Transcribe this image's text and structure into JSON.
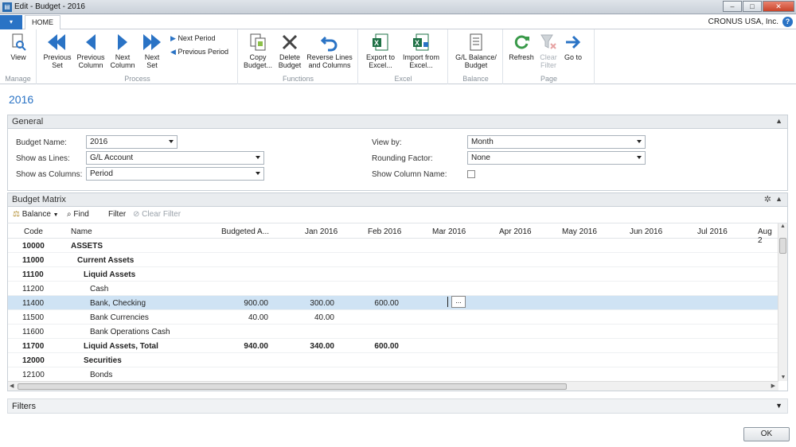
{
  "window": {
    "title": "Edit - Budget - 2016"
  },
  "tabs": {
    "file": "▾",
    "home": "HOME"
  },
  "company": "CRONUS USA, Inc.",
  "ribbon": {
    "view": "View",
    "manage": "Manage",
    "previous_set": "Previous Set",
    "previous_column": "Previous Column",
    "next_column": "Next Column",
    "next_set": "Next Set",
    "next_period": "Next Period",
    "previous_period": "Previous Period",
    "process": "Process",
    "copy_budget": "Copy Budget...",
    "delete_budget": "Delete Budget",
    "reverse_lines": "Reverse Lines and Columns",
    "functions": "Functions",
    "export_excel": "Export to Excel...",
    "import_excel": "Import from Excel...",
    "excel": "Excel",
    "gl_balance_budget": "G/L Balance/ Budget",
    "balance": "Balance",
    "refresh": "Refresh",
    "clear_filter": "Clear Filter",
    "go_to": "Go to",
    "page": "Page"
  },
  "page_title": "2016",
  "general": {
    "header": "General",
    "budget_name_label": "Budget Name:",
    "budget_name": "2016",
    "show_as_lines_label": "Show as Lines:",
    "show_as_lines": "G/L Account",
    "show_as_columns_label": "Show as Columns:",
    "show_as_columns": "Period",
    "view_by_label": "View by:",
    "view_by": "Month",
    "rounding_label": "Rounding Factor:",
    "rounding": "None",
    "show_column_name_label": "Show Column Name:"
  },
  "matrix": {
    "header": "Budget Matrix",
    "toolbar": {
      "balance": "Balance",
      "find": "Find",
      "filter": "Filter",
      "clear_filter": "Clear Filter"
    },
    "columns": [
      "Code",
      "Name",
      "Budgeted A...",
      "Jan 2016",
      "Feb 2016",
      "Mar 2016",
      "Apr 2016",
      "May 2016",
      "Jun 2016",
      "Jul 2016",
      "Aug 2"
    ],
    "rows": [
      {
        "code": "10000",
        "name": "ASSETS",
        "budget": "",
        "jan": "",
        "feb": "",
        "bold": true,
        "indent": 0
      },
      {
        "code": "11000",
        "name": "Current Assets",
        "budget": "",
        "jan": "",
        "feb": "",
        "bold": true,
        "indent": 1
      },
      {
        "code": "11100",
        "name": "Liquid Assets",
        "budget": "",
        "jan": "",
        "feb": "",
        "bold": true,
        "indent": 2
      },
      {
        "code": "11200",
        "name": "Cash",
        "budget": "",
        "jan": "",
        "feb": "",
        "bold": false,
        "indent": 3
      },
      {
        "code": "11400",
        "name": "Bank, Checking",
        "budget": "900.00",
        "jan": "300.00",
        "feb": "600.00",
        "bold": false,
        "indent": 3
      },
      {
        "code": "11500",
        "name": "Bank Currencies",
        "budget": "40.00",
        "jan": "40.00",
        "feb": "",
        "bold": false,
        "indent": 3
      },
      {
        "code": "11600",
        "name": "Bank Operations Cash",
        "budget": "",
        "jan": "",
        "feb": "",
        "bold": false,
        "indent": 3
      },
      {
        "code": "11700",
        "name": "Liquid Assets, Total",
        "budget": "940.00",
        "jan": "340.00",
        "feb": "600.00",
        "bold": true,
        "indent": 2
      },
      {
        "code": "12000",
        "name": "Securities",
        "budget": "",
        "jan": "",
        "feb": "",
        "bold": true,
        "indent": 2
      },
      {
        "code": "12100",
        "name": "Bonds",
        "budget": "",
        "jan": "",
        "feb": "",
        "bold": false,
        "indent": 3
      }
    ],
    "ellipsis": "..."
  },
  "filters": {
    "header": "Filters"
  },
  "ok": "OK"
}
